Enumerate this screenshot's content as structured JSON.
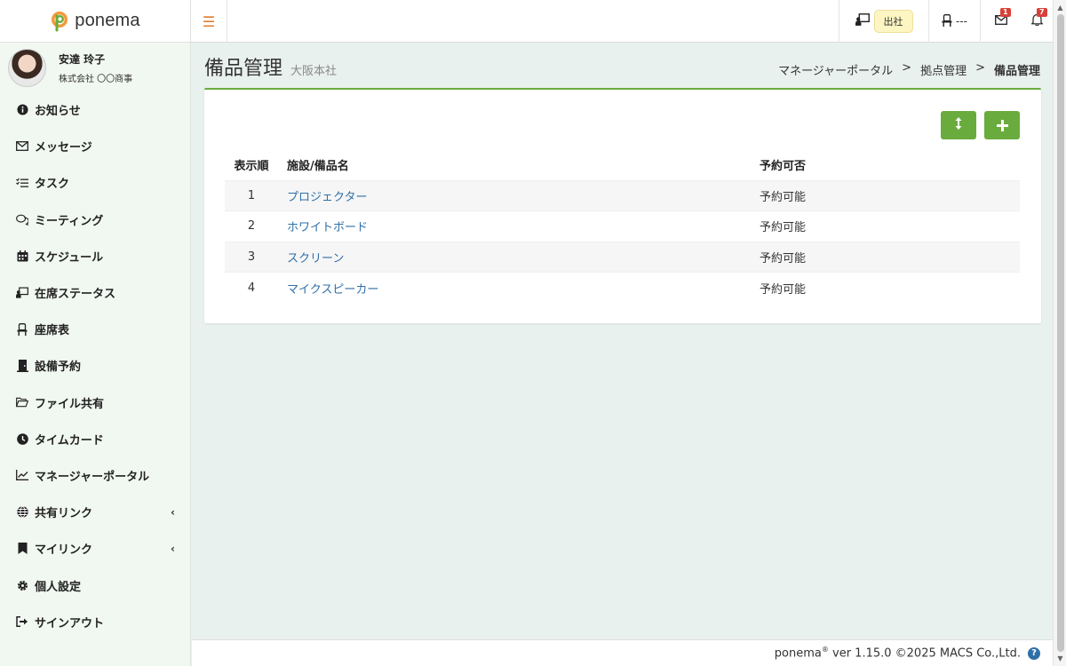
{
  "app": {
    "logo_text": "ponema"
  },
  "profile": {
    "name": "安達 玲子",
    "company": "株式会社 〇〇商事"
  },
  "sidebar": {
    "items": [
      {
        "label": "お知らせ",
        "icon": "info-circle-icon"
      },
      {
        "label": "メッセージ",
        "icon": "envelope-icon"
      },
      {
        "label": "タスク",
        "icon": "checklist-icon"
      },
      {
        "label": "ミーティング",
        "icon": "chat-bubbles-icon"
      },
      {
        "label": "スケジュール",
        "icon": "calendar-icon"
      },
      {
        "label": "在席ステータス",
        "icon": "presence-board-icon"
      },
      {
        "label": "座席表",
        "icon": "chair-icon"
      },
      {
        "label": "設備予約",
        "icon": "door-icon"
      },
      {
        "label": "ファイル共有",
        "icon": "folder-open-icon"
      },
      {
        "label": "タイムカード",
        "icon": "clock-icon"
      },
      {
        "label": "マネージャーポータル",
        "icon": "line-chart-icon"
      },
      {
        "label": "共有リンク",
        "icon": "globe-icon",
        "caret": "‹"
      },
      {
        "label": "マイリンク",
        "icon": "bookmark-icon",
        "caret": "‹"
      },
      {
        "label": "個人設定",
        "icon": "gear-icon"
      },
      {
        "label": "サインアウト",
        "icon": "sign-out-icon"
      }
    ]
  },
  "header": {
    "status_label": "出社",
    "seat_label": "---",
    "mail_count": "1",
    "notification_count": "7"
  },
  "page": {
    "title": "備品管理",
    "subtitle": "大阪本社",
    "breadcrumb": [
      "マネージャーポータル",
      "拠点管理",
      "備品管理"
    ],
    "breadcrumb_sep": ">"
  },
  "table": {
    "headers": {
      "order": "表示順",
      "name": "施設/備品名",
      "reservable": "予約可否"
    },
    "rows": [
      {
        "order": "1",
        "name": "プロジェクター",
        "reservable": "予約可能"
      },
      {
        "order": "2",
        "name": "ホワイトボード",
        "reservable": "予約可能"
      },
      {
        "order": "3",
        "name": "スクリーン",
        "reservable": "予約可能"
      },
      {
        "order": "4",
        "name": "マイクスピーカー",
        "reservable": "予約可能"
      }
    ]
  },
  "footer": {
    "app": "ponema",
    "reg": "®",
    "version": "ver 1.15.0 ©2025 MACS Co.,Ltd.",
    "help": "?"
  },
  "colors": {
    "accent_green": "#6aab3e",
    "hamburger_orange": "#e07b2e",
    "link_blue": "#2f6fa8",
    "badge_red": "#d9403a"
  }
}
